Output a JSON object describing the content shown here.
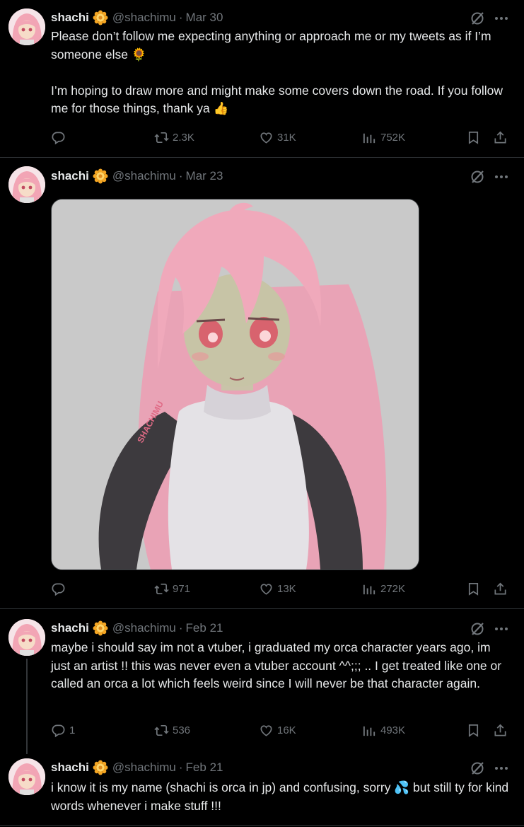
{
  "tweets": [
    {
      "name": "shachi",
      "handle": "@shachimu",
      "dot": "·",
      "date": "Mar 30",
      "text": "Please don’t follow me expecting anything or approach me or my tweets as if I’m someone else 🌻\n\nI’m hoping to draw more and might make some covers down the road. If you follow me for those things, thank ya 👍",
      "reply_count": "",
      "retweet_count": "2.3K",
      "like_count": "31K",
      "view_count": "752K"
    },
    {
      "name": "shachi",
      "handle": "@shachimu",
      "dot": "·",
      "date": "Mar 23",
      "text": "",
      "media_signature": "SHACHIMU",
      "reply_count": "",
      "retweet_count": "971",
      "like_count": "13K",
      "view_count": "272K"
    },
    {
      "name": "shachi",
      "handle": "@shachimu",
      "dot": "·",
      "date": "Feb 21",
      "text": "maybe i should say im not a vtuber, i graduated my orca character years ago, im just an artist !! this was never even a vtuber account ^^;;; .. I get treated like one or called an orca a lot which feels weird since I will never be that character again.",
      "reply_count": "1",
      "retweet_count": "536",
      "like_count": "16K",
      "view_count": "493K"
    },
    {
      "name": "shachi",
      "handle": "@shachimu",
      "dot": "·",
      "date": "Feb 21",
      "text": "i know it is my name (shachi is orca in jp) and confusing, sorry 💦 but still ty for kind words whenever i make stuff !!!"
    }
  ],
  "colors": {
    "bg": "#000000",
    "text": "#e7e9ea",
    "muted": "#71767b",
    "divider": "#2f3336",
    "badge": "#f5a623"
  },
  "icons": [
    "verified-flower-badge",
    "grok-icon",
    "more-icon",
    "reply-icon",
    "retweet-icon",
    "like-icon",
    "views-icon",
    "bookmark-icon",
    "share-icon"
  ]
}
